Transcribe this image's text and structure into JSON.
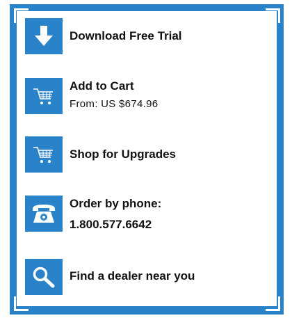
{
  "colors": {
    "accent": "#2a83c8",
    "text": "#111111",
    "background": "#ffffff"
  },
  "links": [
    {
      "label": "Download Free Trial",
      "icon": "download-arrow-icon"
    },
    {
      "label": "Add to Cart",
      "sub": "From: US $674.96",
      "icon": "shopping-cart-icon"
    },
    {
      "label": "Shop for Upgrades",
      "icon": "shopping-cart-icon"
    },
    {
      "label": "Order by phone:",
      "label2": "1.800.577.6642",
      "icon": "telephone-icon"
    },
    {
      "label": "Find a dealer near you",
      "icon": "magnifier-icon"
    }
  ]
}
